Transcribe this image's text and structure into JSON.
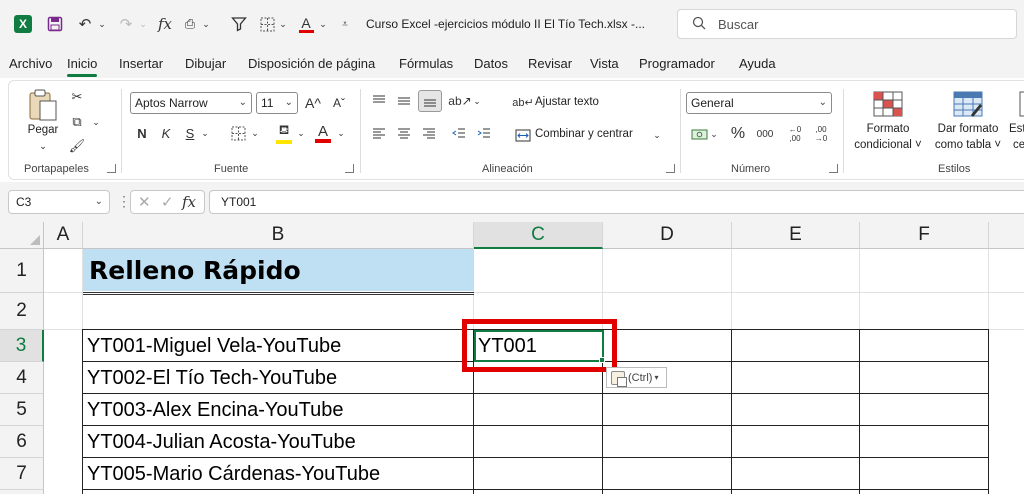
{
  "titlebar": {
    "app_icon": "excel-logo",
    "quick_access": [
      "save-icon",
      "undo-icon",
      "redo-icon",
      "fx-icon",
      "camera-icon",
      "filter-icon",
      "borders-icon",
      "font-color-icon",
      "customize-icon"
    ],
    "document_title": "Curso Excel -ejercicios módulo II El Tío Tech.xlsx  -...",
    "search_placeholder": "Buscar"
  },
  "menu": {
    "tabs": [
      "Archivo",
      "Inicio",
      "Insertar",
      "Dibujar",
      "Disposición de página",
      "Fórmulas",
      "Datos",
      "Revisar",
      "Vista",
      "Programador",
      "Ayuda"
    ],
    "active": "Inicio"
  },
  "ribbon": {
    "clipboard": {
      "label": "Portapapeles",
      "paste": "Pegar"
    },
    "font": {
      "label": "Fuente",
      "font_name": "Aptos Narrow",
      "font_size": "11",
      "bold": "N",
      "italic": "K",
      "underline": "S",
      "grow": "A^",
      "shrink": "Aˇ",
      "font_color_accent": "#e00000",
      "fill_color_accent": "#ffe600"
    },
    "alignment": {
      "label": "Alineación",
      "wrap_text": "Ajustar texto",
      "merge_center": "Combinar y centrar"
    },
    "number": {
      "label": "Número",
      "format": "General",
      "percent": "%",
      "thousands": "000",
      "inc_decimal": "←0 ,00",
      "dec_decimal": ",00 →0"
    },
    "styles": {
      "label": "Estilos",
      "conditional_1": "Formato",
      "conditional_2": "condicional ˅",
      "table_1": "Dar formato",
      "table_2": "como tabla ˅",
      "cell_styles_1": "Est",
      "cell_styles_2": "ce"
    }
  },
  "formula_bar": {
    "name_box": "C3",
    "formula": "YT001"
  },
  "sheet": {
    "columns": [
      "A",
      "B",
      "C",
      "D",
      "E",
      "F"
    ],
    "selected_column": "C",
    "rows": [
      "1",
      "2",
      "3",
      "4",
      "5",
      "6",
      "7"
    ],
    "selected_row": "3",
    "title": "Relleno Rápido",
    "title_fill": "#bfe0f2",
    "b_values": [
      "YT001-Miguel Vela-YouTube",
      "YT002-El Tío Tech-YouTube",
      "YT003-Alex Encina-YouTube",
      "YT004-Julian Acosta-YouTube",
      "YT005-Mario Cárdenas-YouTube"
    ],
    "c3": "YT001",
    "paste_options": "(Ctrl)",
    "accent_green": "#107c41",
    "highlight_red": "#e00000"
  }
}
